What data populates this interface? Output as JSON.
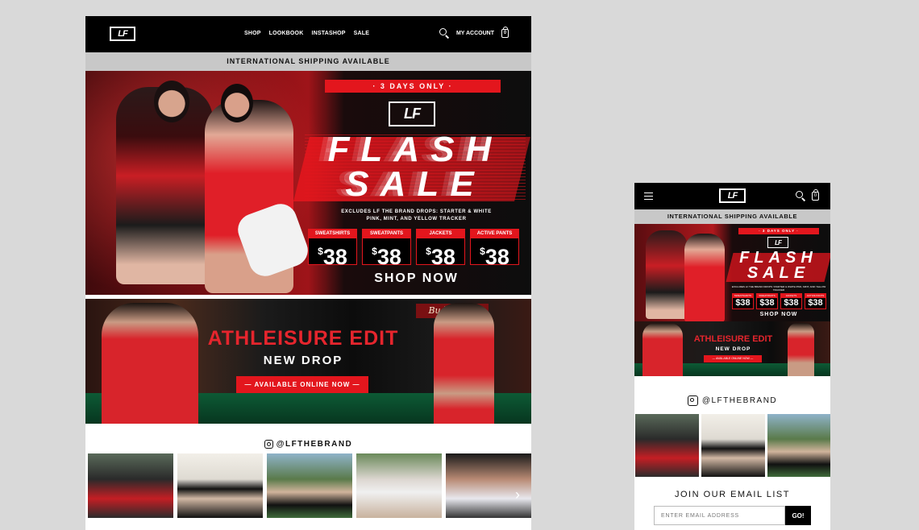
{
  "desktop": {
    "logo_text": "LF",
    "nav": {
      "items": [
        "SHOP",
        "LOOKBOOK",
        "INSTASHOP",
        "SALE"
      ],
      "account": "MY ACCOUNT",
      "cart_count": "0"
    },
    "shipping_banner": "INTERNATIONAL SHIPPING AVAILABLE",
    "hero": {
      "days_only": "· 3 DAYS ONLY ·",
      "headline_1": "FLASH",
      "headline_2": "SALE",
      "excludes_1": "EXCLUDES LF THE BRAND DROPS: STARTER & WHITE",
      "excludes_2": "PINK, MINT, AND YELLOW TRACKER",
      "prices": [
        {
          "label": "SWEATSHIRTS",
          "value": "38"
        },
        {
          "label": "SWEATPANTS",
          "value": "38"
        },
        {
          "label": "JACKETS",
          "value": "38"
        },
        {
          "label": "ACTIVE PANTS",
          "value": "38"
        }
      ],
      "currency": "$",
      "cta": "SHOP NOW"
    },
    "athleisure": {
      "sign": "Budweiser",
      "title": "ATHLEISURE EDIT",
      "subtitle": "NEW DROP",
      "cta": "— AVAILABLE ONLINE NOW —"
    },
    "instagram_handle": "@LFTHEBRAND",
    "next_arrow": "›"
  },
  "mobile": {
    "logo_text": "LF",
    "cart_count": "0",
    "shipping_banner": "INTERNATIONAL SHIPPING AVAILABLE",
    "hero": {
      "days_only": "· 3 DAYS ONLY ·",
      "headline_1": "FLASH",
      "headline_2": "SALE",
      "excludes": "EXCLUDES LF THE BRAND DROPS: STARTER & WHITE PINK, MINT, AND YELLOW TRACKER",
      "prices": [
        {
          "label": "SWEATSHIRTS",
          "value": "$38"
        },
        {
          "label": "SWEATPANTS",
          "value": "$38"
        },
        {
          "label": "JACKETS",
          "value": "$38"
        },
        {
          "label": "ACTIVE PANTS",
          "value": "$38"
        }
      ],
      "cta": "SHOP NOW"
    },
    "athleisure": {
      "title": "ATHLEISURE EDIT",
      "subtitle": "NEW DROP",
      "cta": "— AVAILABLE ONLINE NOW —"
    },
    "instagram_handle": "@LFTHEBRAND",
    "email": {
      "heading": "JOIN OUR EMAIL LIST",
      "placeholder": "ENTER EMAIL ADDRESS",
      "button": "GO!"
    }
  },
  "colors": {
    "accent_red": "#e3161d",
    "nav_bg": "#000000",
    "shipping_bar": "#c8c8c8",
    "page_bg": "#d9d9d9"
  },
  "icons": [
    "search-icon",
    "bag-icon",
    "instagram-icon",
    "hamburger-icon",
    "chevron-right-icon"
  ]
}
